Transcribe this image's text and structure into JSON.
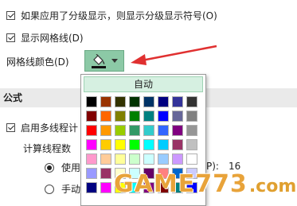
{
  "options": {
    "outline_symbols_label": "如果应用了分级显示，则显示分级显示符号(O)",
    "show_gridlines_label": "显示网格线(D)",
    "gridline_color_label": "网格线颜色(D)"
  },
  "section": {
    "formulas_title": "公式"
  },
  "formulas": {
    "multithread_label": "启用多线程计",
    "thread_count_label": "计算线程数",
    "use_all_label": "使用",
    "use_all_suffix": "P):",
    "use_all_value": "16",
    "manual_label": "手动"
  },
  "palette": {
    "auto_label": "自动",
    "colors": [
      "#000000",
      "#993300",
      "#333300",
      "#003300",
      "#003366",
      "#000080",
      "#333399",
      "#333333",
      "#800000",
      "#ff6600",
      "#808000",
      "#008000",
      "#008080",
      "#0000ff",
      "#666699",
      "#808080",
      "#ff0000",
      "#ff9900",
      "#99cc00",
      "#339966",
      "#33cccc",
      "#3366ff",
      "#800080",
      "#969696",
      "#ff00ff",
      "#ffcc00",
      "#ffff00",
      "#00ff00",
      "#00ffff",
      "#00ccff",
      "#993366",
      "#c0c0c0",
      "#ff99cc",
      "#ffcc99",
      "#ffff99",
      "#ccffcc",
      "#ccffff",
      "#99ccff",
      "#cc99ff",
      "#ffffff",
      "#9999ff",
      "#993366",
      "#ffffcc",
      "#ccffff",
      "#660066",
      "#ff8080",
      "#0066cc",
      "#ccccff",
      "#000080",
      "#ff00ff",
      "#ffff00",
      "#00ffff",
      "#800080",
      "#800000",
      "#008080",
      "#0000ff"
    ]
  },
  "watermark": {
    "brand": "GAME773",
    "suffix": ".com"
  },
  "accent": {
    "button_color": "#8cc9a6",
    "arrow_color": "#e03030",
    "watermark_color": "#e8a33a"
  }
}
